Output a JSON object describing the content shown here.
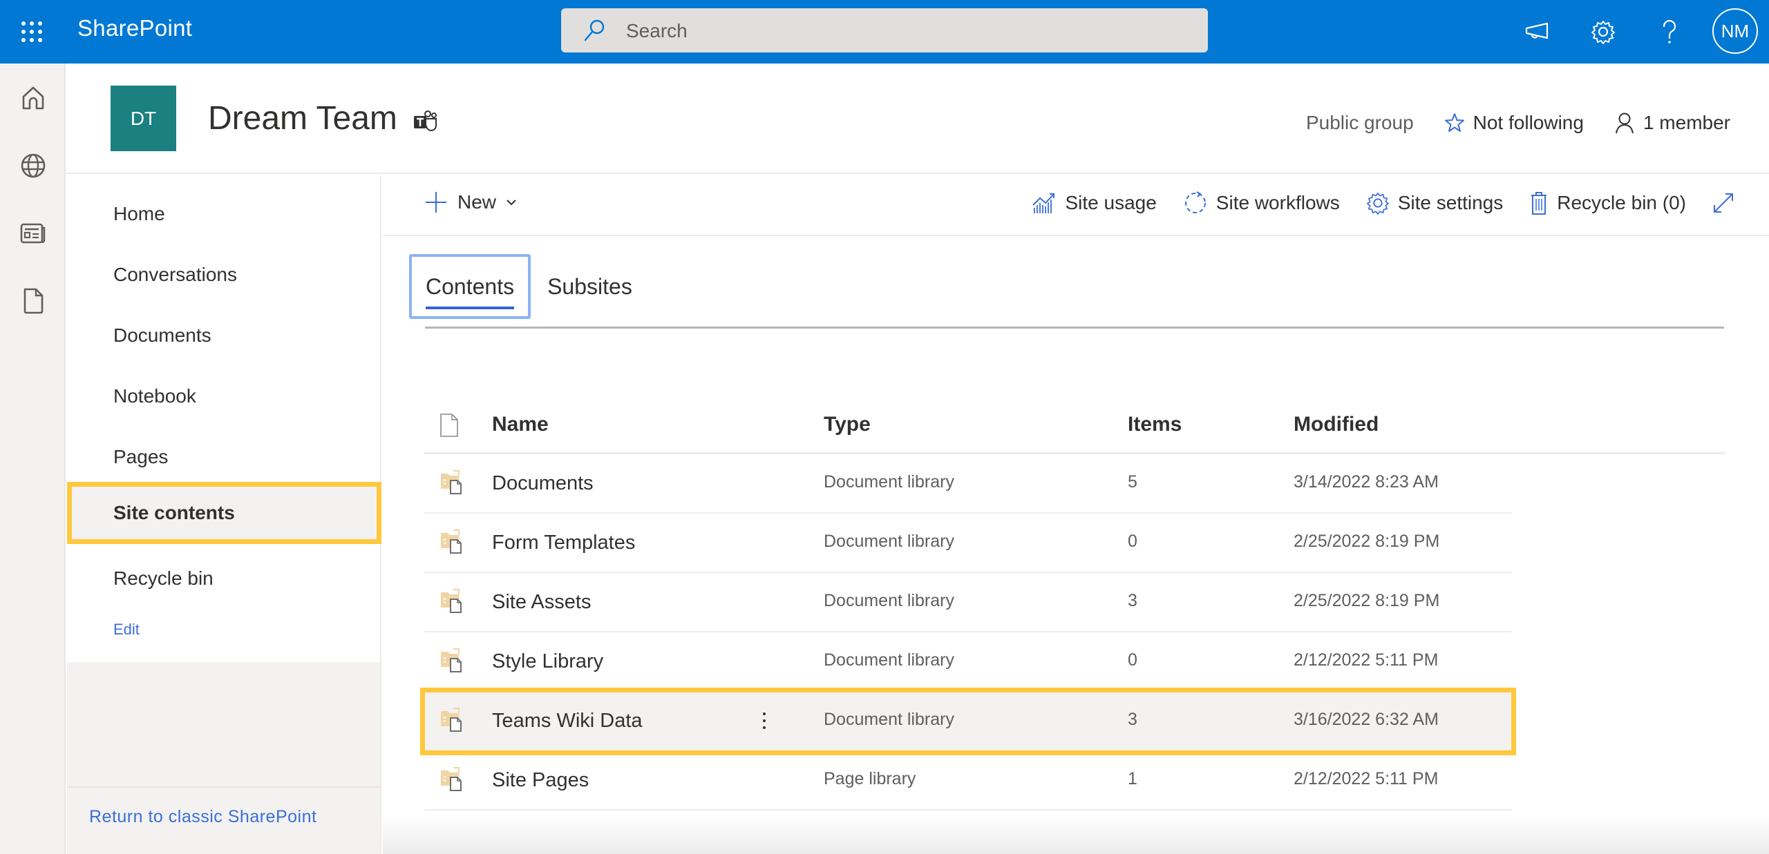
{
  "topbar": {
    "app_name": "SharePoint",
    "search_placeholder": "Search",
    "user_initials": "NM",
    "icons": [
      "waffle-icon",
      "search-icon",
      "megaphone-icon",
      "gear-icon",
      "help-icon"
    ],
    "brand_color": "#0078d4"
  },
  "rail": {
    "icons": [
      "home-icon",
      "globe-icon",
      "news-icon",
      "file-icon"
    ]
  },
  "site": {
    "logo_initials": "DT",
    "logo_color": "#1a8080",
    "title": "Dream Team",
    "privacy": "Public group",
    "follow_label": "Not following",
    "members_label": "1 member"
  },
  "leftnav": {
    "items": [
      {
        "label": "Home"
      },
      {
        "label": "Conversations"
      },
      {
        "label": "Documents"
      },
      {
        "label": "Notebook"
      },
      {
        "label": "Pages"
      },
      {
        "label": "Site contents",
        "selected": true
      },
      {
        "label": "Recycle bin"
      }
    ],
    "edit_label": "Edit",
    "classic_label": "Return to classic SharePoint"
  },
  "commandbar": {
    "new_label": "New",
    "site_usage": "Site usage",
    "site_workflows": "Site workflows",
    "site_settings": "Site settings",
    "recycle_bin": "Recycle bin (0)"
  },
  "tabs": [
    {
      "label": "Contents",
      "active": true
    },
    {
      "label": "Subsites",
      "active": false
    }
  ],
  "table": {
    "columns": {
      "name": "Name",
      "type": "Type",
      "items": "Items",
      "modified": "Modified"
    },
    "rows": [
      {
        "name": "Documents",
        "type": "Document library",
        "items": "5",
        "modified": "3/14/2022 8:23 AM"
      },
      {
        "name": "Form Templates",
        "type": "Document library",
        "items": "0",
        "modified": "2/25/2022 8:19 PM"
      },
      {
        "name": "Site Assets",
        "type": "Document library",
        "items": "3",
        "modified": "2/25/2022 8:19 PM"
      },
      {
        "name": "Style Library",
        "type": "Document library",
        "items": "0",
        "modified": "2/12/2022 5:11 PM"
      },
      {
        "name": "Teams Wiki Data",
        "type": "Document library",
        "items": "3",
        "modified": "3/16/2022 6:32 AM",
        "highlighted": true
      },
      {
        "name": "Site Pages",
        "type": "Page library",
        "items": "1",
        "modified": "2/12/2022 5:11 PM"
      }
    ]
  },
  "highlight_color": "#ffc83d"
}
